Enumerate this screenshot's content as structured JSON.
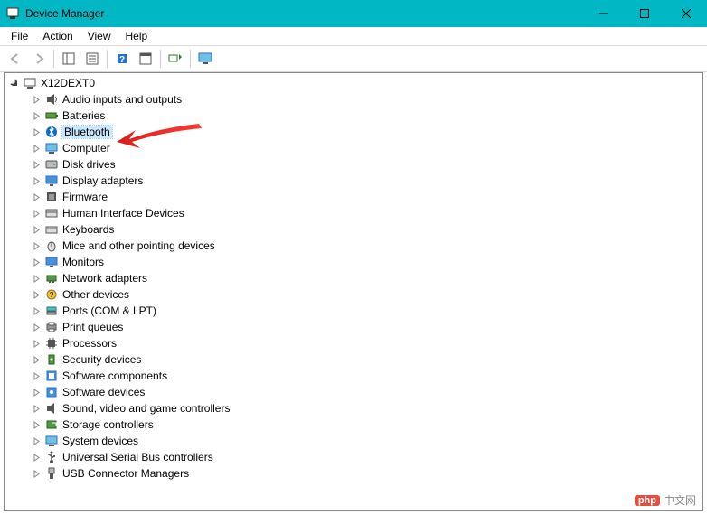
{
  "window": {
    "title": "Device Manager"
  },
  "menu": {
    "file": "File",
    "action": "Action",
    "view": "View",
    "help": "Help"
  },
  "root": {
    "label": "X12DEXT0"
  },
  "nodes": {
    "audio": "Audio inputs and outputs",
    "batteries": "Batteries",
    "bluetooth": "Bluetooth",
    "computer": "Computer",
    "disk": "Disk drives",
    "display": "Display adapters",
    "firmware": "Firmware",
    "hid": "Human Interface Devices",
    "keyboards": "Keyboards",
    "mice": "Mice and other pointing devices",
    "monitors": "Monitors",
    "network": "Network adapters",
    "other": "Other devices",
    "ports": "Ports (COM & LPT)",
    "printq": "Print queues",
    "processors": "Processors",
    "security": "Security devices",
    "swcomp": "Software components",
    "swdev": "Software devices",
    "sound": "Sound, video and game controllers",
    "storage": "Storage controllers",
    "system": "System devices",
    "usb": "Universal Serial Bus controllers",
    "usbconn": "USB Connector Managers"
  },
  "watermark": {
    "tag": "php",
    "text": "中文网"
  }
}
